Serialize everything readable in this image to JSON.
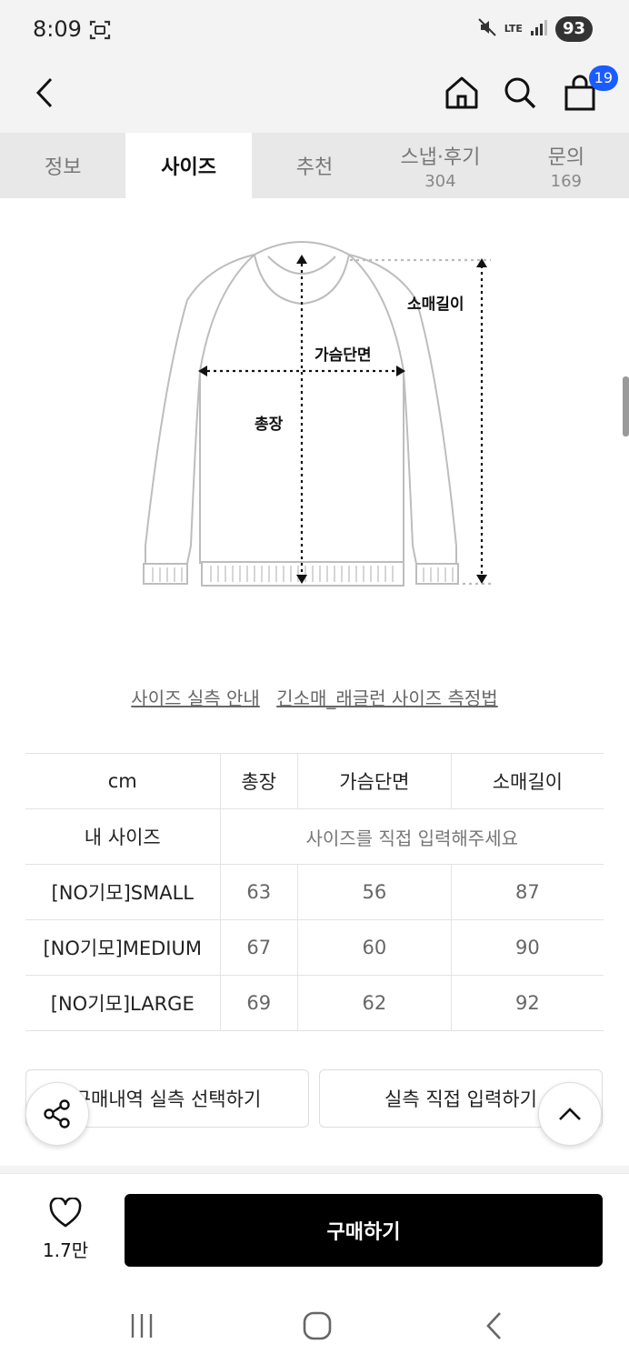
{
  "status_bar": {
    "time": "8:09",
    "network": "LTE",
    "battery": "93"
  },
  "header": {
    "cart_count": "19"
  },
  "tabs": [
    {
      "label": "정보",
      "count": ""
    },
    {
      "label": "사이즈",
      "count": ""
    },
    {
      "label": "추천",
      "count": ""
    },
    {
      "label": "스냅·후기",
      "count": "304"
    },
    {
      "label": "문의",
      "count": "169"
    }
  ],
  "diagram": {
    "sleeve_label": "소매길이",
    "chest_label": "가슴단면",
    "length_label": "총장"
  },
  "guide_links": {
    "measure_guide": "사이즈 실측 안내",
    "method": "긴소매_래글런 사이즈 측정법"
  },
  "size_table": {
    "unit": "cm",
    "columns": [
      "총장",
      "가슴단면",
      "소매길이"
    ],
    "my_size_label": "내 사이즈",
    "my_size_hint": "사이즈를 직접 입력해주세요",
    "rows": [
      {
        "name": "[NO기모]SMALL",
        "values": [
          "63",
          "56",
          "87"
        ]
      },
      {
        "name": "[NO기모]MEDIUM",
        "values": [
          "67",
          "60",
          "90"
        ]
      },
      {
        "name": "[NO기모]LARGE",
        "values": [
          "69",
          "62",
          "92"
        ]
      }
    ]
  },
  "actions": {
    "select_history": "구매내역 실측 선택하기",
    "manual_input": "실측 직접 입력하기"
  },
  "purchase": {
    "like_count": "1.7만",
    "buy_label": "구매하기"
  }
}
